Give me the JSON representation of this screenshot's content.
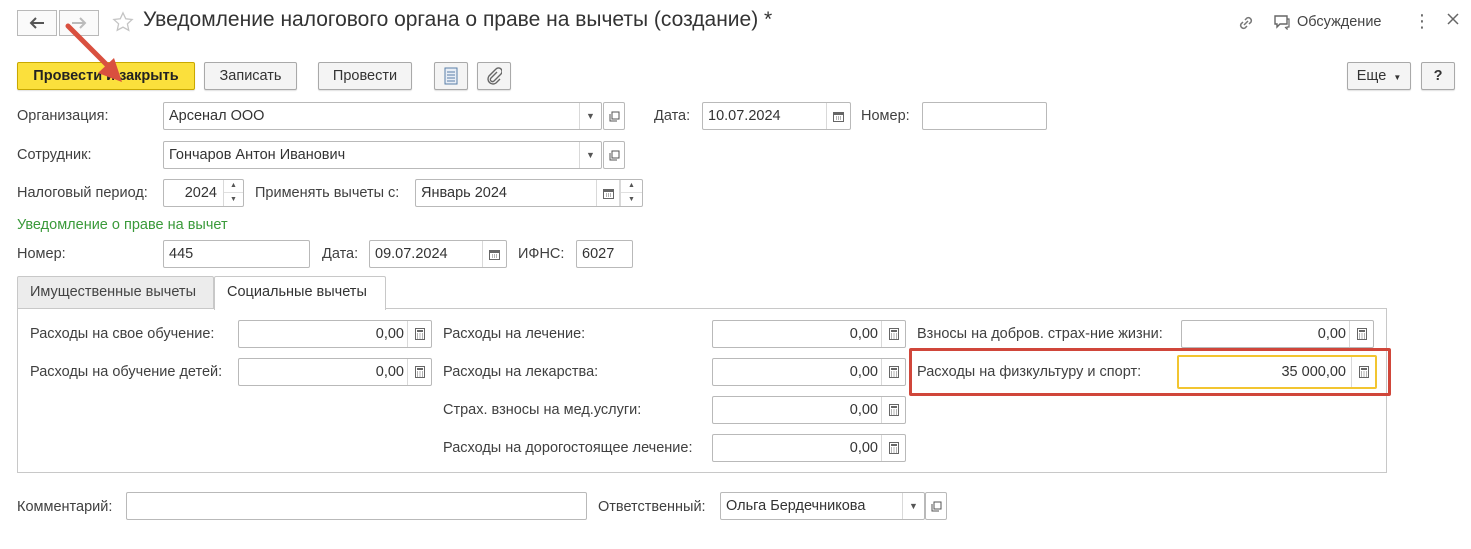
{
  "window": {
    "title": "Уведомление налогового органа о праве на вычеты (создание) *",
    "discussion_label": "Обсуждение"
  },
  "toolbar": {
    "post_and_close": "Провести и закрыть",
    "save": "Записать",
    "post": "Провести",
    "more": "Еще",
    "help": "?"
  },
  "header": {
    "organization_label": "Организация:",
    "organization_value": "Арсенал ООО",
    "date_label": "Дата:",
    "date_value": "10.07.2024",
    "number_label": "Номер:",
    "number_value": "",
    "employee_label": "Сотрудник:",
    "employee_value": "Гончаров Антон Иванович",
    "tax_period_label": "Налоговый период:",
    "tax_period_value": "2024",
    "apply_from_label": "Применять вычеты с:",
    "apply_from_value": "Январь 2024"
  },
  "notice": {
    "section_title": "Уведомление о праве на вычет",
    "number_label": "Номер:",
    "number_value": "445",
    "date_label": "Дата:",
    "date_value": "09.07.2024",
    "ifns_label": "ИФНС:",
    "ifns_value": "6027"
  },
  "tabs": [
    {
      "label": "Имущественные вычеты",
      "active": false
    },
    {
      "label": "Социальные вычеты",
      "active": true
    }
  ],
  "social": {
    "own_education_label": "Расходы на свое обучение:",
    "own_education_value": "0,00",
    "children_education_label": "Расходы на обучение детей:",
    "children_education_value": "0,00",
    "treatment_label": "Расходы на лечение:",
    "treatment_value": "0,00",
    "medicines_label": "Расходы на лекарства:",
    "medicines_value": "0,00",
    "med_insurance_label": "Страх. взносы на мед.услуги:",
    "med_insurance_value": "0,00",
    "expensive_treatment_label": "Расходы на дорогостоящее лечение:",
    "expensive_treatment_value": "0,00",
    "life_insurance_label": "Взносы на добров. страх-ние жизни:",
    "life_insurance_value": "0,00",
    "sport_label": "Расходы на физкультуру и спорт:",
    "sport_value": "35 000,00"
  },
  "footer": {
    "comment_label": "Комментарий:",
    "comment_value": "",
    "responsible_label": "Ответственный:",
    "responsible_value": "Ольга Бердечникова"
  },
  "colors": {
    "primary_button": "#fbe03c",
    "highlight_box": "#d0463a",
    "arrow": "#d9503f",
    "focus_border": "#f2c530",
    "section_title": "#3a9a3a"
  }
}
